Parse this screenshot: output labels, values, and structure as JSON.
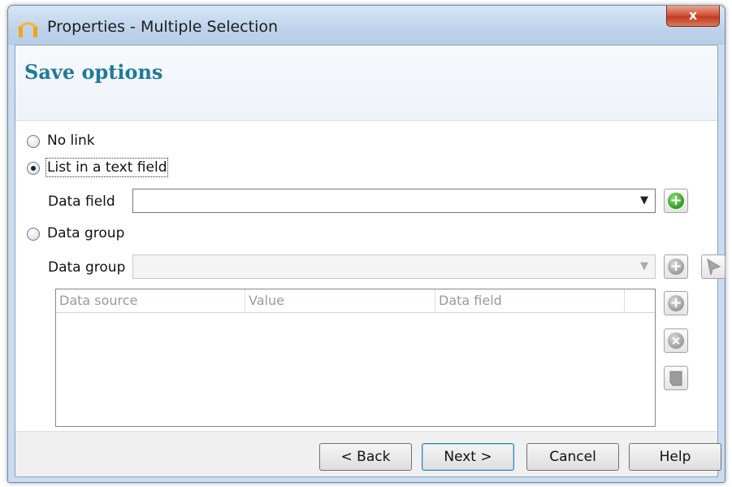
{
  "window": {
    "title": "Properties - Multiple Selection",
    "close_glyph": "x"
  },
  "page": {
    "title": "Save options"
  },
  "options": {
    "no_link": {
      "label": "No link",
      "checked": false
    },
    "list_text_field": {
      "label": "List in a text field",
      "checked": true
    },
    "data_group": {
      "label": "Data group",
      "checked": false
    }
  },
  "data_field": {
    "label": "Data field",
    "value": ""
  },
  "data_group_field": {
    "label": "Data group",
    "value": ""
  },
  "table": {
    "columns": [
      "Data source",
      "Value",
      "Data field"
    ],
    "rows": []
  },
  "buttons": {
    "back": "< Back",
    "next": "Next >",
    "cancel": "Cancel",
    "help": "Help"
  },
  "colors": {
    "title_teal": "#1f7a99",
    "add_green": "#2e9a20",
    "close_red": "#c23b1f"
  },
  "icons": [
    "app-logo-icon",
    "close-icon",
    "chevron-down-icon",
    "add-icon",
    "remove-icon",
    "edit-icon",
    "flag-icon"
  ]
}
